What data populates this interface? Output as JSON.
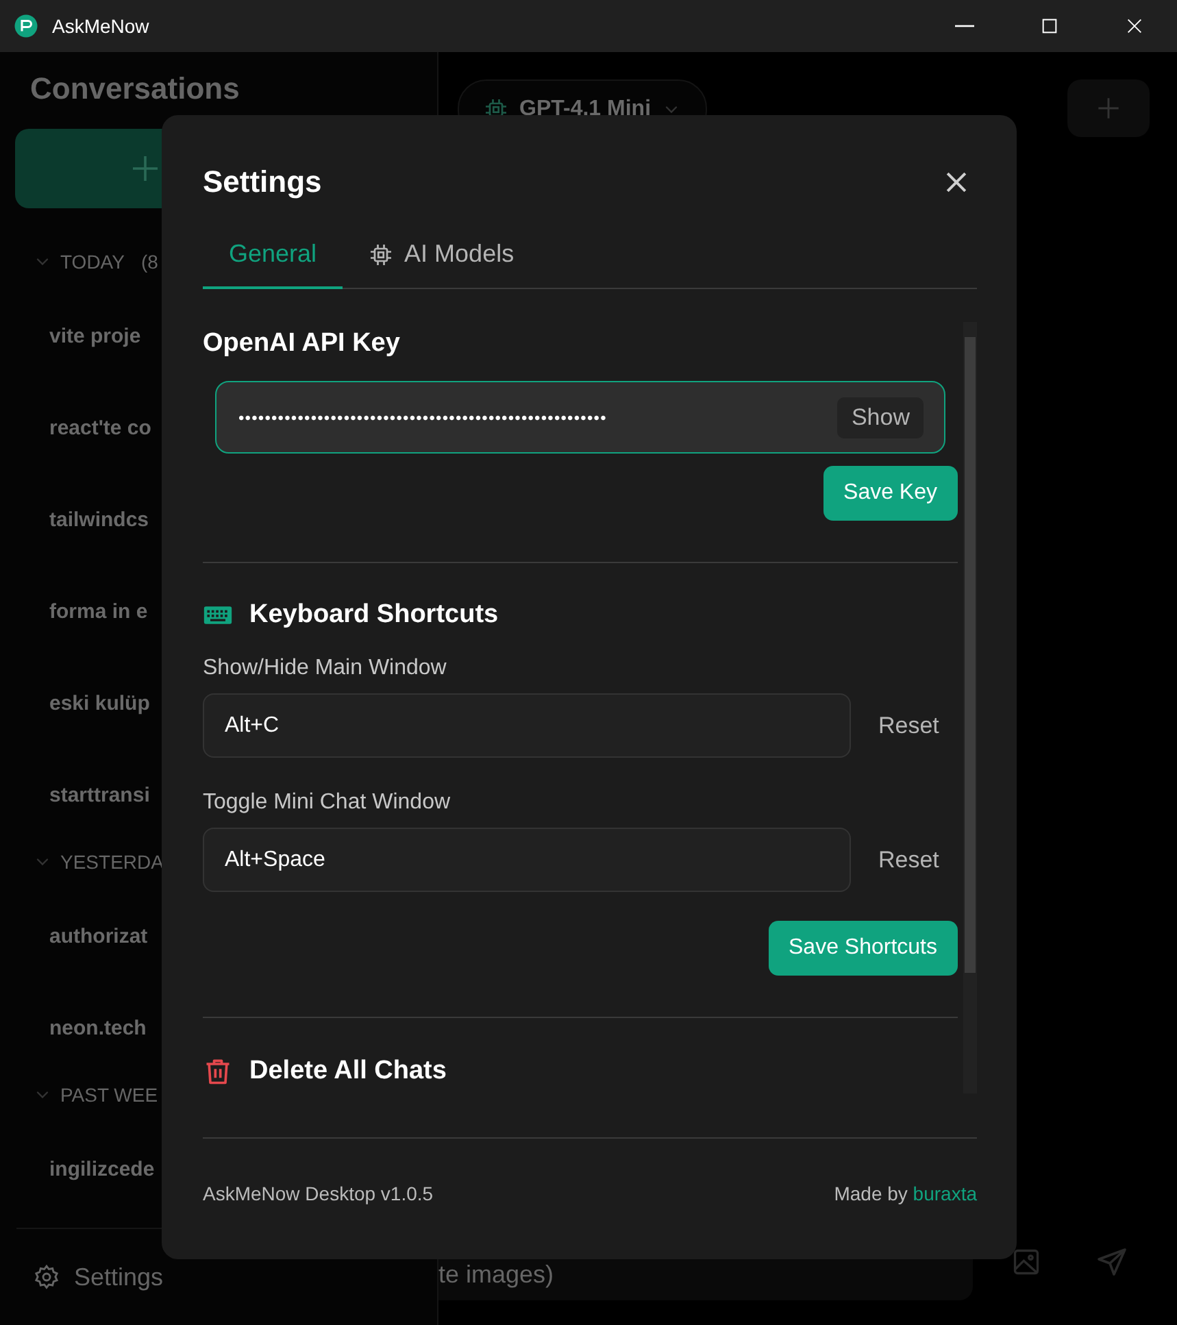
{
  "window": {
    "title": "AskMeNow"
  },
  "sidebar": {
    "heading": "Conversations",
    "groups": [
      {
        "label": "TODAY",
        "count": "(8",
        "expanded": true,
        "items": [
          "vite proje",
          "react'te co",
          "tailwindcs",
          "forma in e",
          "eski kulüp",
          "starttransi"
        ]
      },
      {
        "label": "YESTERDA",
        "expanded": true,
        "items": [
          "authorizat",
          "neon.tech"
        ]
      },
      {
        "label": "PAST WEE",
        "expanded": true,
        "items": [
          "ingilizcede"
        ]
      }
    ],
    "settings_label": "Settings"
  },
  "chat": {
    "model": "GPT-4.1 Mini",
    "placeholder": "te images)"
  },
  "settings": {
    "title": "Settings",
    "tabs": [
      {
        "label": "General",
        "kind": "general",
        "selected": true
      },
      {
        "label": "AI Models",
        "kind": "models",
        "selected": false
      }
    ],
    "api_key": {
      "heading": "OpenAI API Key",
      "masked_value": "••••••••••••••••••••••••••••••••••••••••••••••••••••••••",
      "show_button": "Show",
      "save_button": "Save Key"
    },
    "shortcuts": {
      "heading": "Keyboard Shortcuts",
      "items": [
        {
          "label": "Show/Hide Main Window",
          "value": "Alt+C",
          "reset": "Reset"
        },
        {
          "label": "Toggle Mini Chat Window",
          "value": "Alt+Space",
          "reset": "Reset"
        }
      ],
      "save_button": "Save Shortcuts"
    },
    "danger": {
      "heading": "Delete All Chats"
    },
    "footer": {
      "version": "AskMeNow Desktop v1.0.5",
      "credit": "Made by ",
      "author": "buraxta"
    }
  }
}
